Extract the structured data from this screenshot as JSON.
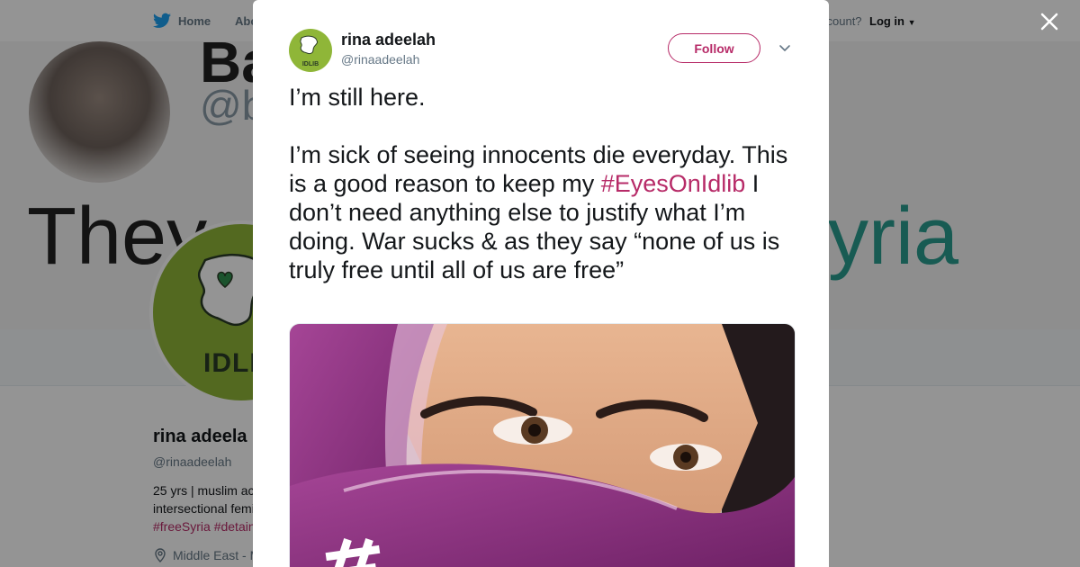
{
  "topnav": {
    "home_label": "Home",
    "about_label": "Abo",
    "account_prompt": "ccount?",
    "login_label": "Log in"
  },
  "banner": {
    "line1": "Ba",
    "line2": "@b",
    "line3": "They",
    "line4": "yria"
  },
  "profile": {
    "avatar_text": "IDLIB",
    "name": "rina adeela",
    "handle": "@rinaadeelah",
    "bio_line1": "25 yrs | muslim ac",
    "bio_line2": "intersectional femi",
    "tags": "#freeSyria #detain",
    "location": "Middle East - M"
  },
  "tweet": {
    "author_name": "rina adeelah",
    "author_handle": "@rinaadeelah",
    "avatar_text": "IDLIB",
    "follow_label": "Follow",
    "paragraph1": "I’m still here.",
    "paragraph2_before": "I’m sick of seeing innocents die everyday. This is a good reason to keep my ",
    "hashtag": "#EyesOnIdlib",
    "paragraph2_after": " I don’t need anything else to justify what I’m doing. War sucks & as they say “none of us is truly free until all of us are free”"
  },
  "colors": {
    "accent": "#b72b68",
    "brand_green": "#8fb638",
    "text_secondary": "#657786",
    "scarf_purple": "#8c2a7c"
  },
  "icons": {
    "close": "close-icon",
    "chevron": "chevron-down-icon",
    "twitter": "twitter-bird-icon",
    "location": "location-pin-icon"
  }
}
